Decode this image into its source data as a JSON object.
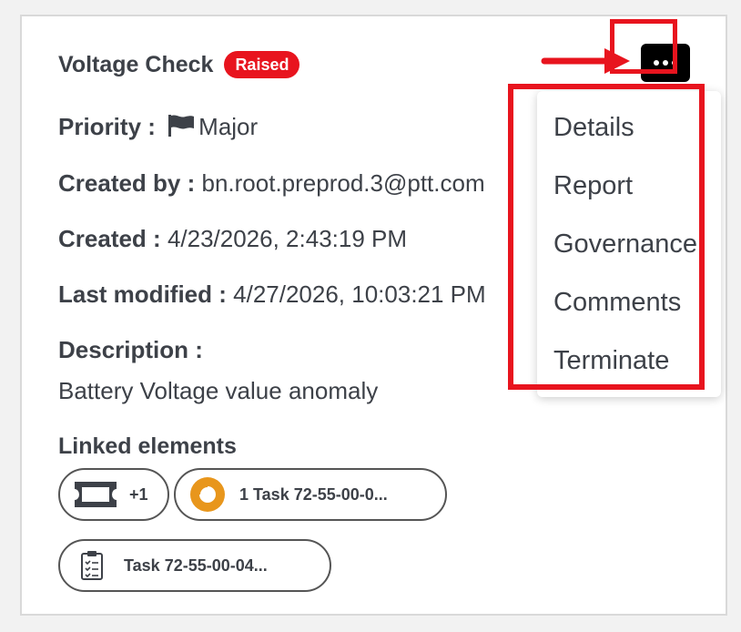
{
  "card": {
    "title": "Voltage Check",
    "status_badge": "Raised",
    "priority": {
      "label": "Priority :",
      "value": "Major"
    },
    "created_by": {
      "label": "Created by :",
      "value": "bn.root.preprod.3@ptt.com"
    },
    "created": {
      "label": "Created :",
      "value": "4/23/2026, 2:43:19 PM"
    },
    "last_modified": {
      "label": "Last modified :",
      "value": "4/27/2026, 10:03:21 PM"
    },
    "description": {
      "label": "Description :",
      "value": "Battery Voltage value anomaly"
    },
    "linked_elements": {
      "label": "Linked elements",
      "chips": [
        {
          "icon": "ticket-icon",
          "text": "+1"
        },
        {
          "icon": "progress-ring-icon",
          "text": "1 Task 72-55-00-0..."
        },
        {
          "icon": "clipboard-checklist-icon",
          "text": "Task 72-55-00-04..."
        }
      ]
    }
  },
  "menu": {
    "button_icon": "more-horizontal-icon",
    "items": [
      {
        "label": "Details"
      },
      {
        "label": "Report"
      },
      {
        "label": "Governance"
      },
      {
        "label": "Comments"
      },
      {
        "label": "Terminate"
      }
    ]
  },
  "colors": {
    "badge": "#e8141e",
    "highlight": "#e8141e",
    "text": "#3d4148",
    "progress_ring": "#e8961c"
  }
}
